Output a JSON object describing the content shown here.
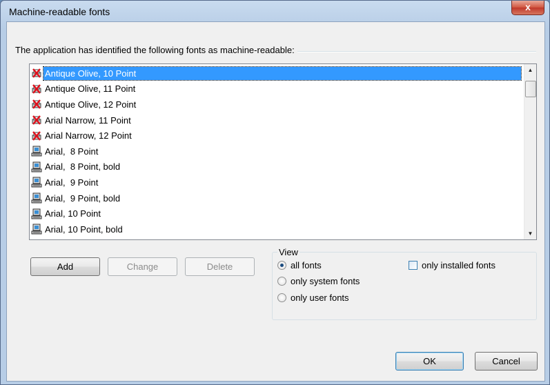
{
  "window": {
    "title": "Machine-readable fonts",
    "close_label": "x"
  },
  "group_label": "The application has identified the following fonts as machine-readable:",
  "fonts": [
    {
      "label": "Antique Olive, 10 Point",
      "icon": "printer-font-red-x-icon",
      "selected": true
    },
    {
      "label": "Antique Olive, 11 Point",
      "icon": "printer-font-red-x-icon",
      "selected": false
    },
    {
      "label": "Antique Olive, 12 Point",
      "icon": "printer-font-red-x-icon",
      "selected": false
    },
    {
      "label": "Arial Narrow, 11 Point",
      "icon": "printer-font-red-x-icon",
      "selected": false
    },
    {
      "label": "Arial Narrow, 12 Point",
      "icon": "printer-font-red-x-icon",
      "selected": false
    },
    {
      "label": "Arial,  8 Point",
      "icon": "system-font-computer-icon",
      "selected": false
    },
    {
      "label": "Arial,  8 Point, bold",
      "icon": "system-font-computer-icon",
      "selected": false
    },
    {
      "label": "Arial,  9 Point",
      "icon": "system-font-computer-icon",
      "selected": false
    },
    {
      "label": "Arial,  9 Point, bold",
      "icon": "system-font-computer-icon",
      "selected": false
    },
    {
      "label": "Arial, 10 Point",
      "icon": "system-font-computer-icon",
      "selected": false
    },
    {
      "label": "Arial, 10 Point, bold",
      "icon": "system-font-computer-icon",
      "selected": false
    }
  ],
  "buttons": {
    "add": "Add",
    "change": "Change",
    "delete": "Delete",
    "ok": "OK",
    "cancel": "Cancel"
  },
  "view": {
    "label": "View",
    "options": [
      {
        "label": "all fonts",
        "checked": true
      },
      {
        "label": "only system fonts",
        "checked": false
      },
      {
        "label": "only user fonts",
        "checked": false
      }
    ],
    "only_installed_label": "only installed fonts",
    "only_installed_checked": false
  },
  "colors": {
    "selection": "#3399ff",
    "title_bar": "#b7cde6",
    "close_button": "#c0392b"
  }
}
